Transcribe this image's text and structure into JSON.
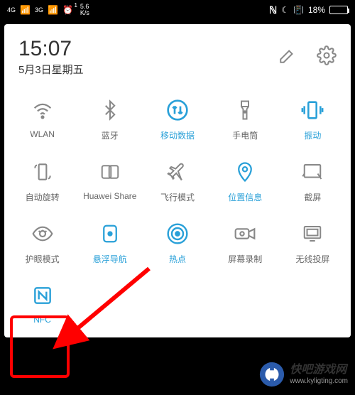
{
  "statusBar": {
    "signal1": "4G",
    "signal2": "3G",
    "alarmBadge": "1",
    "speed": "5.6",
    "speedUnit": "K/s",
    "batteryPct": "18%"
  },
  "header": {
    "time": "15:07",
    "date": "5月3日星期五"
  },
  "tiles": [
    {
      "id": "wlan",
      "label": "WLAN",
      "active": false
    },
    {
      "id": "bluetooth",
      "label": "蓝牙",
      "active": false
    },
    {
      "id": "mobile-data",
      "label": "移动数据",
      "active": true
    },
    {
      "id": "flashlight",
      "label": "手电筒",
      "active": false
    },
    {
      "id": "vibrate",
      "label": "振动",
      "active": true
    },
    {
      "id": "auto-rotate",
      "label": "自动旋转",
      "active": false
    },
    {
      "id": "huawei-share",
      "label": "Huawei Share",
      "active": false
    },
    {
      "id": "airplane",
      "label": "飞行模式",
      "active": false
    },
    {
      "id": "location",
      "label": "位置信息",
      "active": true
    },
    {
      "id": "screenshot",
      "label": "截屏",
      "active": false
    },
    {
      "id": "eye-comfort",
      "label": "护眼模式",
      "active": false
    },
    {
      "id": "float-nav",
      "label": "悬浮导航",
      "active": true
    },
    {
      "id": "hotspot",
      "label": "热点",
      "active": true
    },
    {
      "id": "screen-record",
      "label": "屏幕录制",
      "active": false
    },
    {
      "id": "wireless-proj",
      "label": "无线投屏",
      "active": false
    },
    {
      "id": "nfc",
      "label": "NFC",
      "active": true
    }
  ],
  "watermark": {
    "title": "快吧游戏网",
    "url": "www.kyligting.com"
  }
}
